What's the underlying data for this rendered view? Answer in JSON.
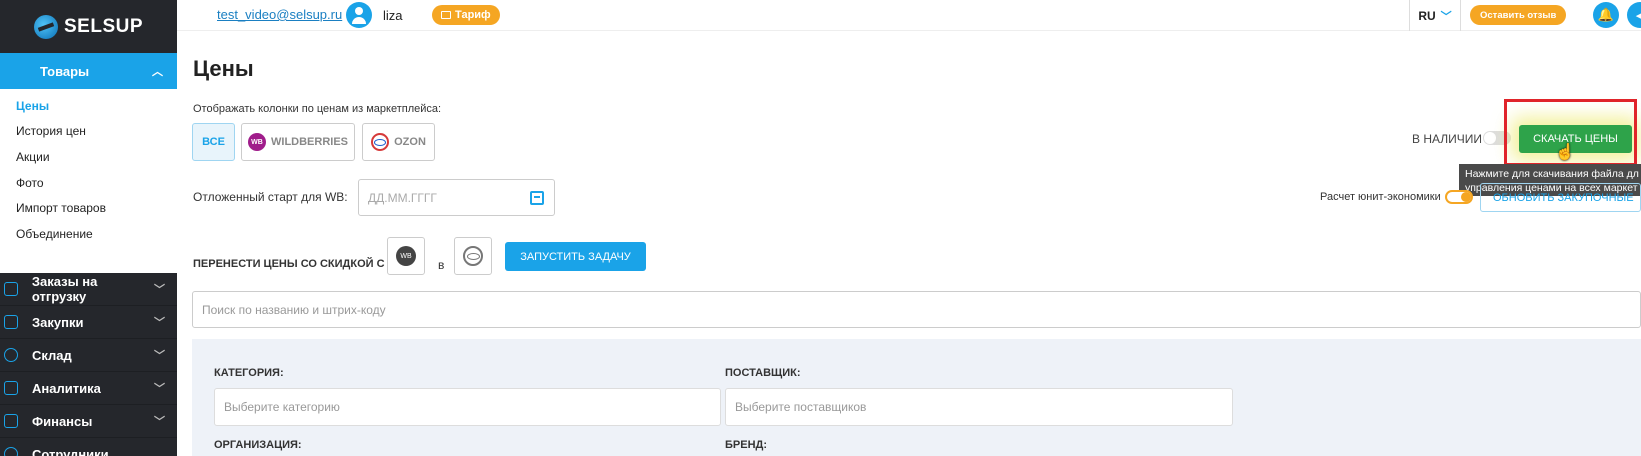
{
  "brand": {
    "name": "SELSUP",
    "accent": "#1aa3e8"
  },
  "topbar": {
    "email": "test_video@selsup.ru",
    "username": "liza",
    "tariff_label": "Тариф",
    "lang": "RU",
    "feedback_label": "Оставить отзыв"
  },
  "sidebar": {
    "active_section": "Товары",
    "sub_items": [
      "Цены",
      "История цен",
      "Акции",
      "Фото",
      "Импорт товаров",
      "Объединение"
    ],
    "items": [
      {
        "label": "Заказы на отгрузку",
        "icon": "box-icon"
      },
      {
        "label": "Закупки",
        "icon": "cart-icon"
      },
      {
        "label": "Склад",
        "icon": "warehouse-icon"
      },
      {
        "label": "Аналитика",
        "icon": "chart-icon"
      },
      {
        "label": "Финансы",
        "icon": "wallet-icon"
      },
      {
        "label": "Сотрудники",
        "icon": "user-icon"
      }
    ]
  },
  "main": {
    "title": "Цены",
    "marketplace_label": "Отображать колонки по ценам из маркетплейса:",
    "marketplaces": {
      "all": "ВСЕ",
      "wb": "WILDBERRIES",
      "ozon": "OZON"
    },
    "in_stock_label": "В НАЛИЧИИ",
    "download_label": "СКАЧАТЬ ЦЕНЫ",
    "tooltip_line1": "Нажмите для скачивания файла дл",
    "tooltip_line2": "управления ценами на всех маркет",
    "wb_start_label": "Отложенный старт для WB:",
    "date_placeholder": "ДД.ММ.ГГГГ",
    "unit_econ_label": "Расчет юнит-экономики",
    "update_label": "ОБНОВИТЬ ЗАКУПОЧНЫЕ",
    "transfer_label": "ПЕРЕНЕСТИ ЦЕНЫ СО СКИДКОЙ С",
    "transfer_to": "в",
    "wb_short": "WB",
    "run_label": "ЗАПУСТИТЬ ЗАДАЧУ",
    "search_placeholder": "Поиск по названию и штрих-коду"
  },
  "filters": {
    "category_label": "КАТЕГОРИЯ:",
    "category_placeholder": "Выберите категорию",
    "supplier_label": "ПОСТАВЩИК:",
    "supplier_placeholder": "Выберите поставщиков",
    "org_label": "ОРГАНИЗАЦИЯ:",
    "brand_label": "БРЕНД:"
  }
}
